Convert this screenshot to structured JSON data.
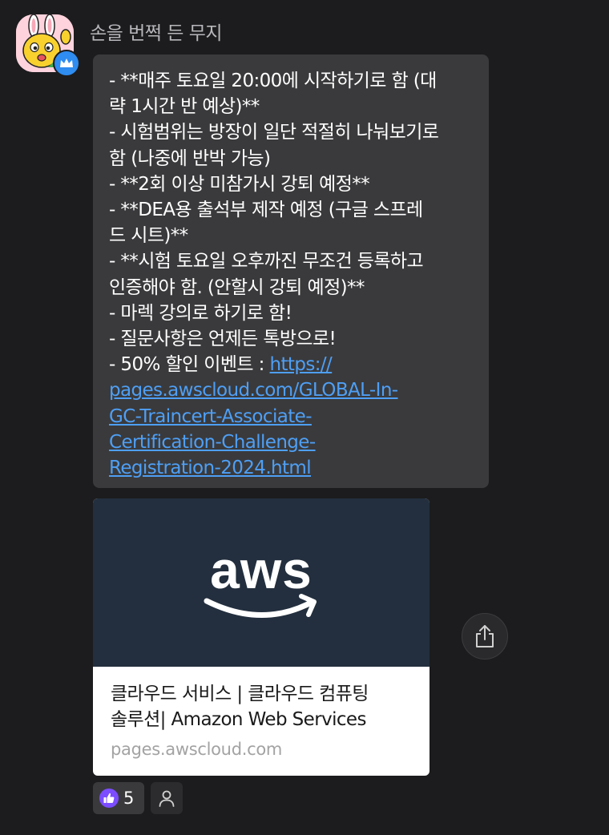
{
  "message": {
    "sender_name": "손을 번쩍 든 무지",
    "avatar_icon": "muzi-rabbit-avatar",
    "badge_icon": "crown-badge-icon",
    "lines": [
      "- **매주 토요일 20:00에 시작하기로 함 (대",
      "략 1시간 반 예상)**",
      "- 시험범위는 방장이 일단 적절히 나눠보기로",
      "함 (나중에 반박 가능)",
      "- **2회 이상 미참가시 강퇴 예정**",
      "- **DEA용 출석부 제작 예정 (구글 스프레",
      "드 시트)**",
      "- **시험 토요일 오후까진 무조건 등록하고",
      "인증해야 함. (안할시 강퇴 예정)**",
      "- 마렉 강의로 하기로 함!",
      "- 질문사항은 언제든 톡방으로!"
    ],
    "link_prefix": "- 50% 할인 이벤트 : ",
    "link_lines": [
      "https://",
      "pages.awscloud.com/GLOBAL-In-",
      "GC-Traincert-Associate-",
      "Certification-Challenge-",
      "Registration-2024.html"
    ]
  },
  "link_preview": {
    "logo_text": "aws",
    "title_line1": "클라우드 서비스 | 클라우드 컴퓨팅",
    "title_line2": "솔루션| Amazon Web Services",
    "domain": "pages.awscloud.com"
  },
  "actions": {
    "share_icon": "share-icon",
    "like_icon": "thumbs-up-icon",
    "like_count": "5",
    "reactors_icon": "person-icon"
  },
  "colors": {
    "background": "#1c1c1e",
    "bubble": "#3a3a3c",
    "link": "#4e9ff5",
    "aws_bg": "#232f3e",
    "like_purple": "#7b4dff"
  }
}
